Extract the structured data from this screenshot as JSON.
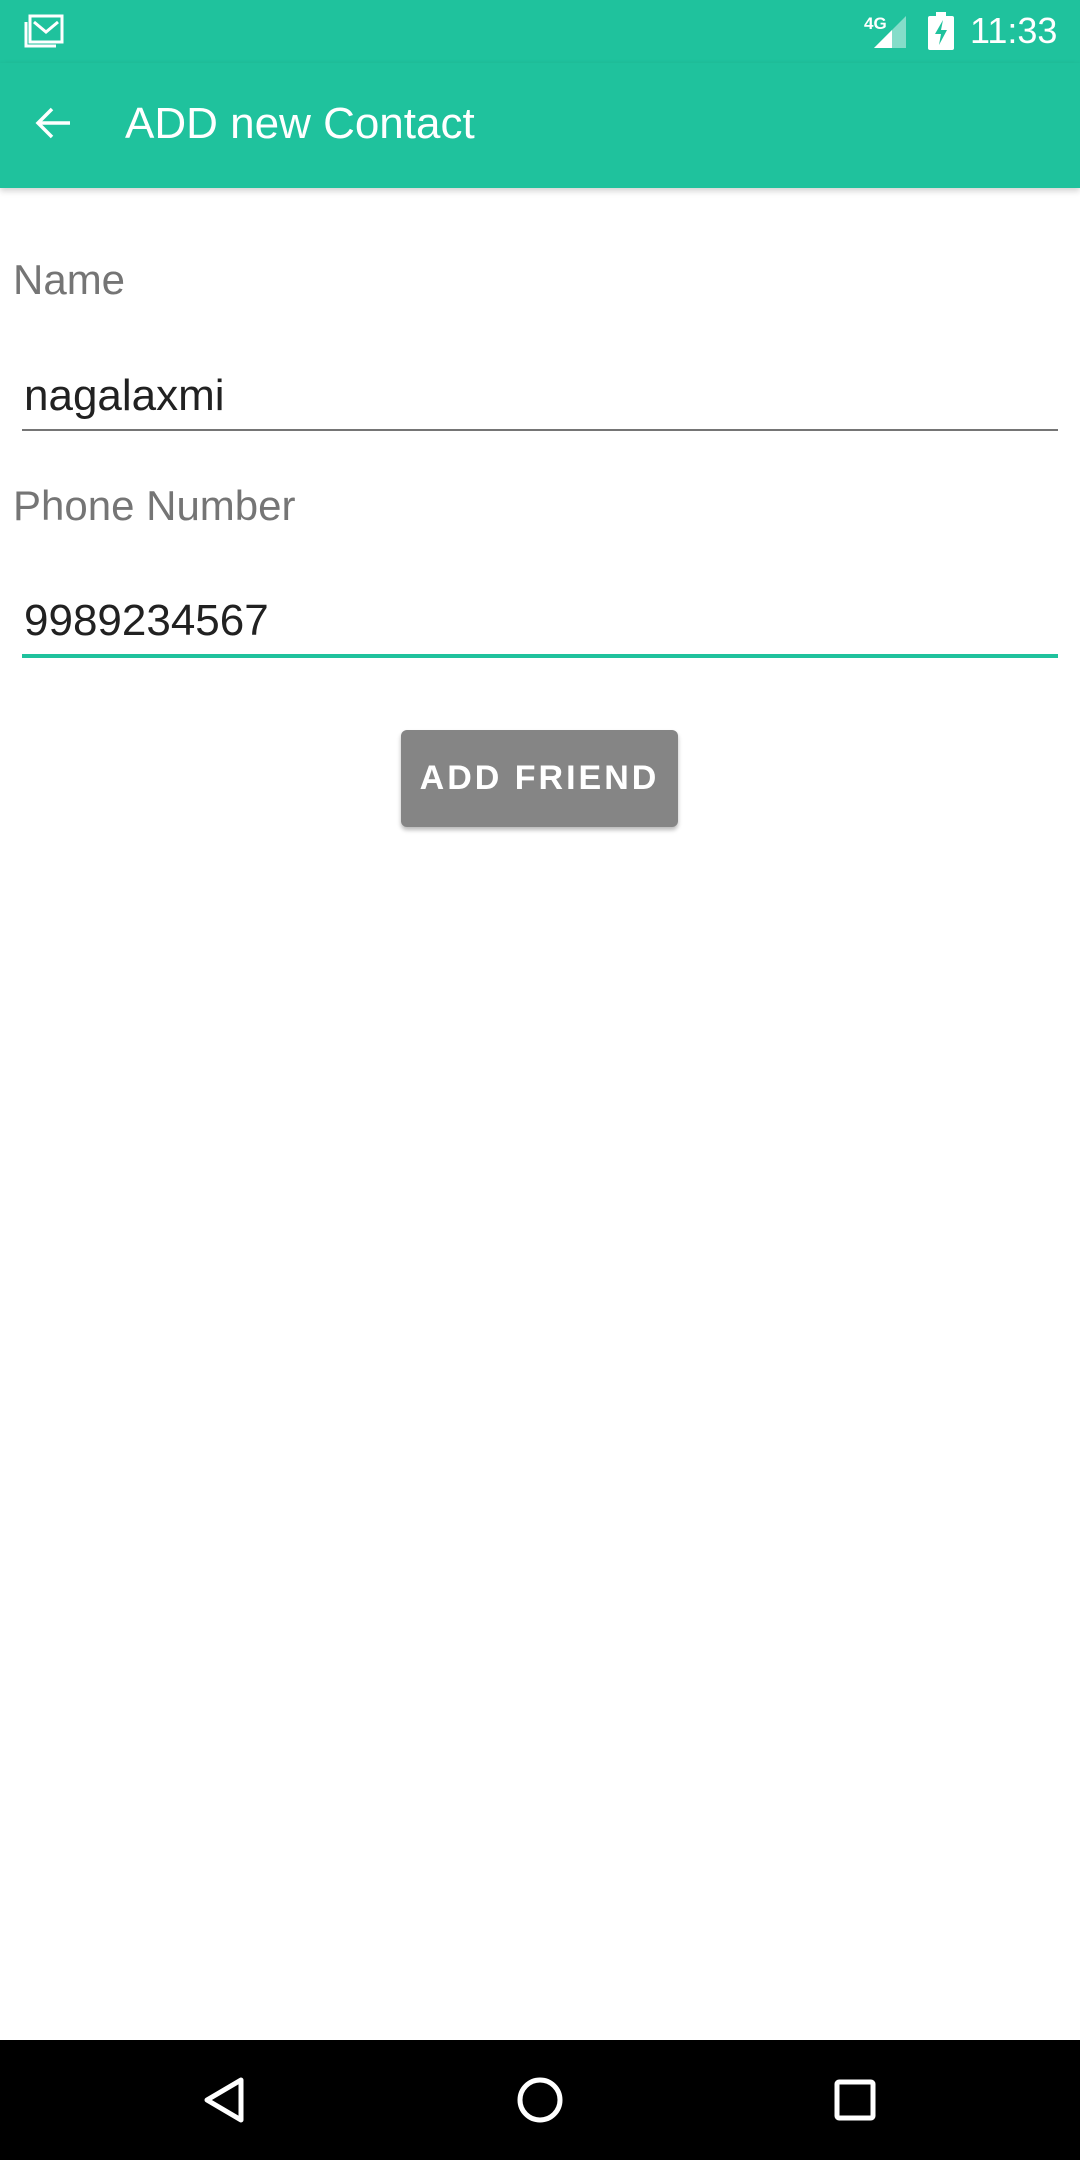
{
  "status_bar": {
    "time": "11:33",
    "network": "4G",
    "icons": [
      "gmail-icon",
      "signal-icon",
      "battery-charging-icon"
    ]
  },
  "app_bar": {
    "title": "ADD new Contact",
    "back_icon": "arrow-back-icon"
  },
  "form": {
    "name_label": "Name",
    "name_value": "nagalaxmi",
    "phone_label": "Phone Number",
    "phone_value": "9989234567",
    "submit_label": "ADD FRIEND"
  },
  "nav_bar": {
    "icons": [
      "back-triangle-icon",
      "home-circle-icon",
      "recents-square-icon"
    ]
  },
  "colors": {
    "accent": "#1fc29d",
    "button": "#858585",
    "label": "#757575",
    "text": "#212121"
  }
}
